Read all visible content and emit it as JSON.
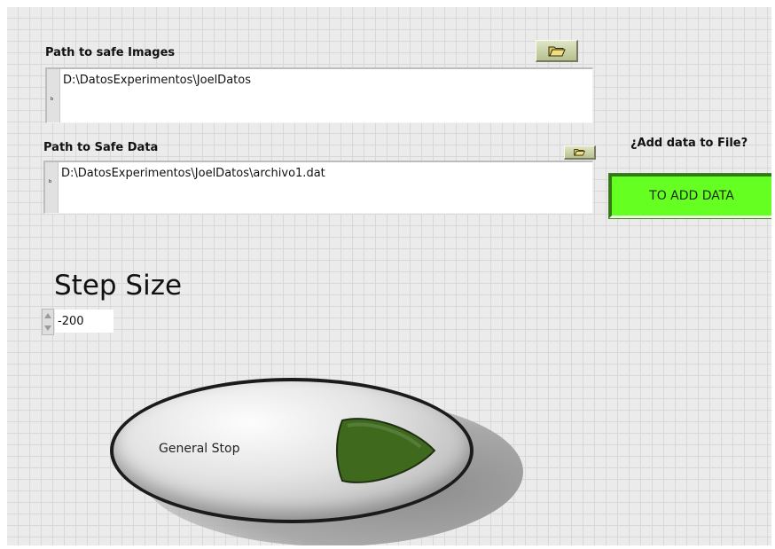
{
  "images_path": {
    "label": "Path to safe Images",
    "value": "D:\\DatosExperimentos\\JoelDatos",
    "browse_icon": "folder-open-icon"
  },
  "data_path": {
    "label": "Path to Safe Data",
    "value": "D:\\DatosExperimentos\\JoelDatos\\archivo1.dat",
    "browse_icon": "folder-open-icon"
  },
  "add_data": {
    "question": "¿Add data to File?",
    "button_label": "TO ADD DATA",
    "color": "#66ff22"
  },
  "step_size": {
    "label": "Step Size",
    "value": "-200"
  },
  "general_stop": {
    "label": "General Stop",
    "led_color": "#3f6a1e"
  }
}
